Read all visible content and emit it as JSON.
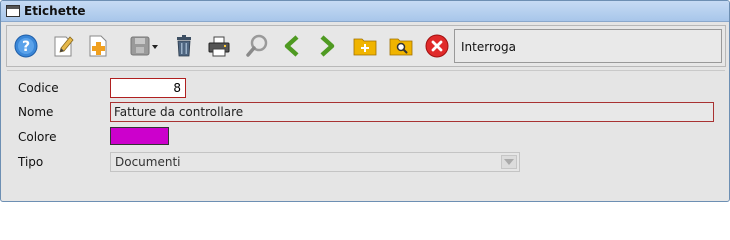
{
  "window": {
    "title": "Etichette"
  },
  "toolbar": {
    "buttons": [
      {
        "name": "help-button",
        "icon": "help-icon"
      },
      {
        "name": "edit-button",
        "icon": "edit-document-icon"
      },
      {
        "name": "new-button",
        "icon": "new-document-icon"
      },
      {
        "name": "save-button",
        "icon": "save-dropdown-icon"
      },
      {
        "name": "delete-button",
        "icon": "trash-icon"
      },
      {
        "name": "print-button",
        "icon": "printer-icon"
      },
      {
        "name": "search-button",
        "icon": "magnifier-icon"
      },
      {
        "name": "previous-button",
        "icon": "chevron-left-icon"
      },
      {
        "name": "next-button",
        "icon": "chevron-right-icon"
      },
      {
        "name": "add-folder-button",
        "icon": "folder-add-icon"
      },
      {
        "name": "search-folder-button",
        "icon": "folder-search-icon"
      },
      {
        "name": "close-button",
        "icon": "close-red-icon"
      }
    ],
    "mode_text": "Interroga"
  },
  "form": {
    "codice_label": "Codice",
    "codice_value": "8",
    "nome_label": "Nome",
    "nome_value": "Fatture da controllare",
    "colore_label": "Colore",
    "colore_value": "#cc00cc",
    "tipo_label": "Tipo",
    "tipo_value": "Documenti"
  },
  "colors": {
    "title_bar": "#b3cdee",
    "required_border": "#b02020",
    "accent_green": "#5aa52a",
    "accent_blue": "#2f7fd6"
  }
}
